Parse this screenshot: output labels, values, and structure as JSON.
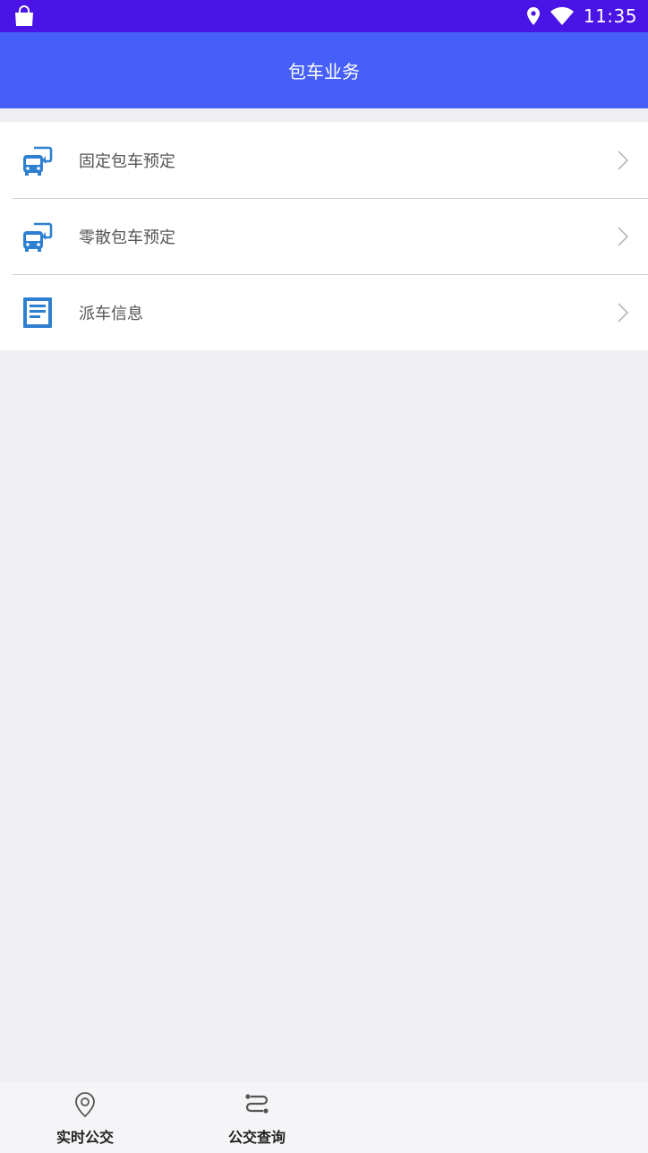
{
  "status_bar": {
    "time": "11:35"
  },
  "header": {
    "title": "包车业务"
  },
  "menu": {
    "items": [
      {
        "label": "固定包车预定",
        "icon": "bus-transfer-icon"
      },
      {
        "label": "零散包车预定",
        "icon": "bus-transfer-icon"
      },
      {
        "label": "派车信息",
        "icon": "document-icon"
      }
    ]
  },
  "bottom_nav": {
    "tabs": [
      {
        "label": "实时公交",
        "icon": "location-pin-icon"
      },
      {
        "label": "公交查询",
        "icon": "route-icon"
      }
    ]
  },
  "colors": {
    "status_bar": "#4a14e6",
    "app_bar": "#465ff8",
    "icon_blue": "#2f7fd0",
    "background": "#eeeef3"
  }
}
